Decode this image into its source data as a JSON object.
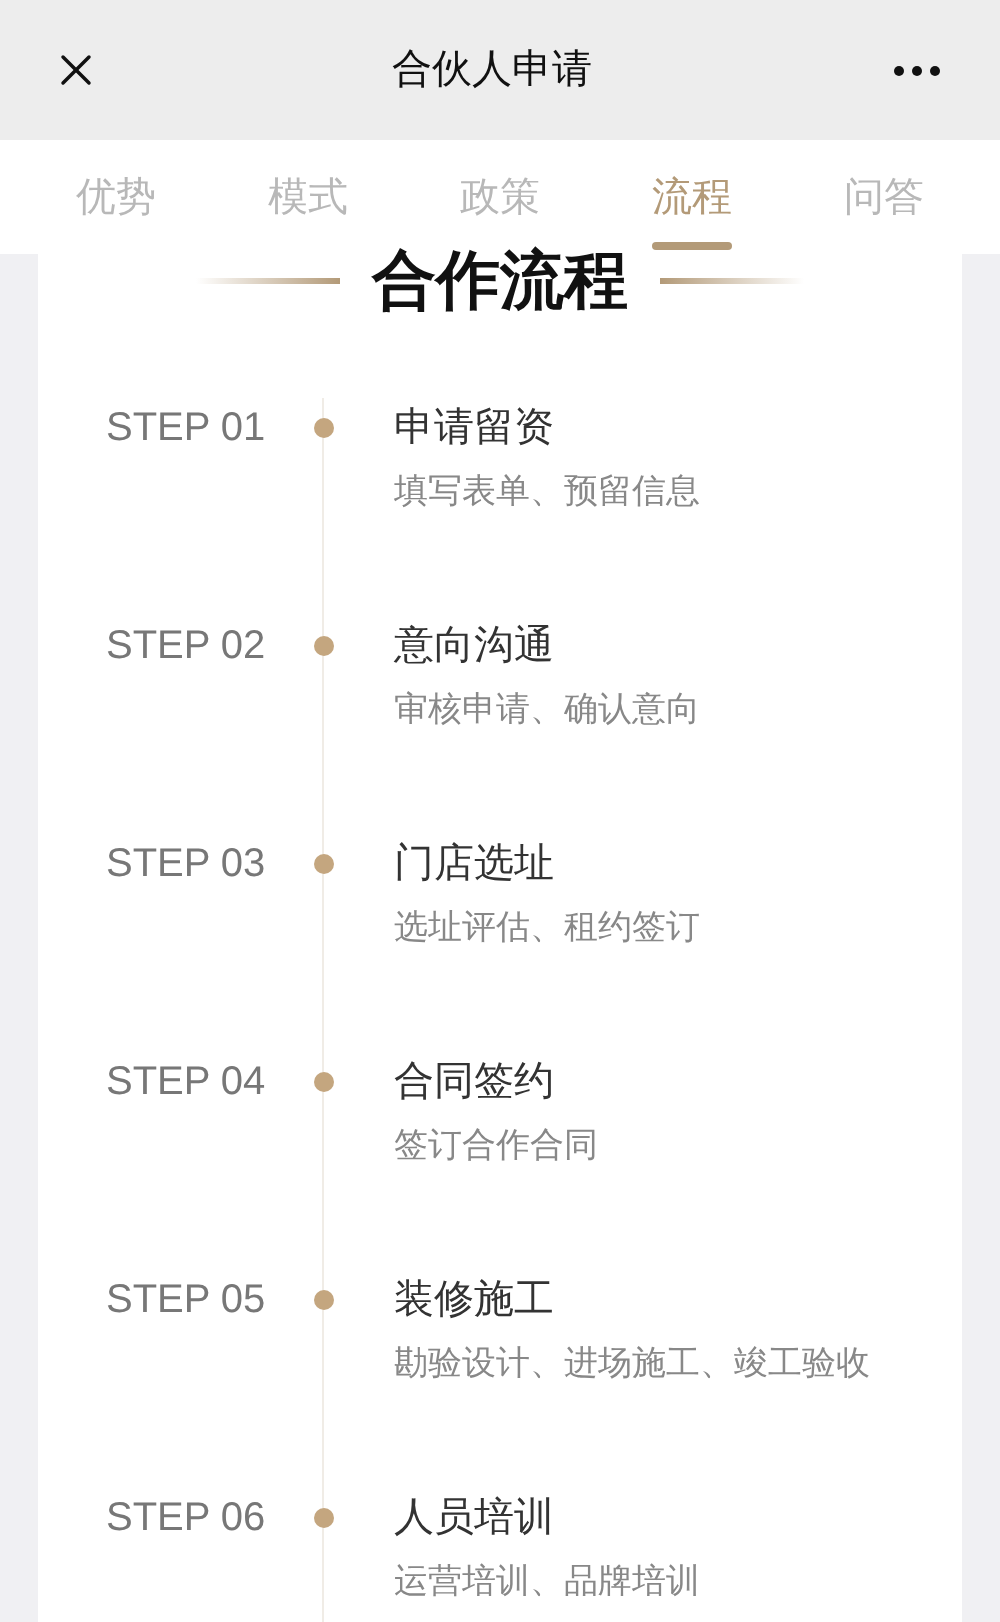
{
  "nav_bar": {
    "title": "合伙人申请"
  },
  "tabs": [
    {
      "label": "优势",
      "selected": false
    },
    {
      "label": "模式",
      "selected": false
    },
    {
      "label": "政策",
      "selected": false
    },
    {
      "label": "流程",
      "selected": true
    },
    {
      "label": "问答",
      "selected": false
    }
  ],
  "section": {
    "title": "合作流程"
  },
  "steps": [
    {
      "label": "STEP 01",
      "title": "申请留资",
      "description": "填写表单、预留信息"
    },
    {
      "label": "STEP 02",
      "title": "意向沟通",
      "description": "审核申请、确认意向"
    },
    {
      "label": "STEP 03",
      "title": "门店选址",
      "description": "选址评估、租约签订"
    },
    {
      "label": "STEP 04",
      "title": "合同签约",
      "description": "签订合作合同"
    },
    {
      "label": "STEP 05",
      "title": "装修施工",
      "description": "勘验设计、进场施工、竣工验收"
    },
    {
      "label": "STEP 06",
      "title": "人员培训",
      "description": "运营培训、品牌培训"
    }
  ]
}
